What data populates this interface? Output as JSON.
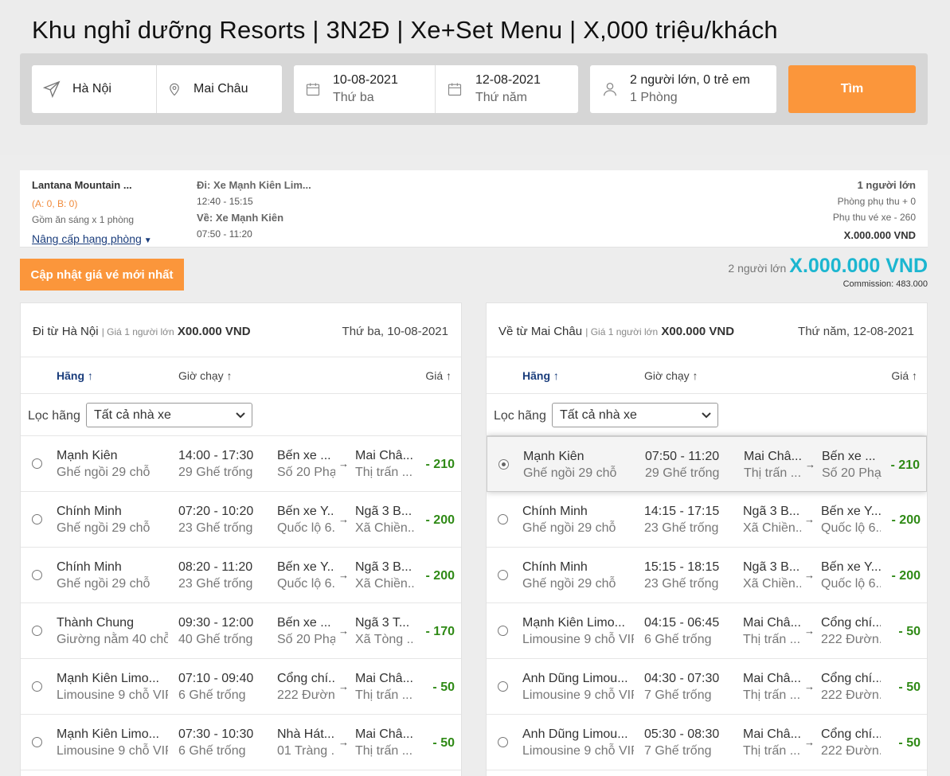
{
  "page": {
    "title": "Khu nghỉ dưỡng Resorts | 3N2Đ | Xe+Set Menu | X,000 triệu/khách"
  },
  "search": {
    "origin": "Hà Nội",
    "destination": "Mai Châu",
    "depart_date": "10-08-2021",
    "depart_day": "Thứ ba",
    "return_date": "12-08-2021",
    "return_day": "Thứ năm",
    "guests": "2 người lớn, 0 trẻ em",
    "rooms": "1 Phòng",
    "search_label": "Tìm"
  },
  "summary": {
    "hotel_name": "Lantana Mountain ...",
    "occupancy": "(A: 0, B: 0)",
    "meal": "Gồm ăn sáng x 1 phòng",
    "upgrade_label": "Nâng cấp hạng phòng",
    "outbound_label": "Đi: Xe Mạnh Kiên Lim...",
    "outbound_time": "12:40 - 15:15",
    "return_label": "Về: Xe Mạnh Kiên",
    "return_time": "07:50 - 11:20",
    "adults": "1 người lớn",
    "room_surcharge": "Phòng phụ thu + 0",
    "ticket_surcharge": "Phụ thu vé xe - 260",
    "total": "X.000.000 VND"
  },
  "actions": {
    "update_label": "Cập nhật giá vé mới nhất"
  },
  "price": {
    "pax": "2 người lớn",
    "total": "X.000.000 VND",
    "commission": "Commission: 483.000"
  },
  "outbound": {
    "from_label": "Đi từ Hà Nội",
    "price_note": "| Giá 1 người lớn",
    "price": "X00.000 VND",
    "date": "Thứ ba, 10-08-2021",
    "col_company": "Hãng ↑",
    "col_time": "Giờ chạy ↑",
    "col_price": "Giá ↑",
    "filter_label": "Lọc hãng",
    "filter_value": "Tất cả nhà xe",
    "rows": [
      {
        "name": "Mạnh Kiên",
        "type": "Ghế ngồi 29 chỗ",
        "time": "14:00 - 17:30",
        "seats": "29 Ghế trống",
        "from": "Bến xe ...",
        "from_addr": "Số 20 Phạ...",
        "to": "Mai Châ...",
        "to_addr": "Thị trấn ...",
        "price": "- 210",
        "selected": false
      },
      {
        "name": "Chính Minh",
        "type": "Ghế ngồi 29 chỗ",
        "time": "07:20 - 10:20",
        "seats": "23 Ghế trống",
        "from": "Bến xe Y...",
        "from_addr": "Quốc lộ 6...",
        "to": "Ngã 3 B...",
        "to_addr": "Xã Chiền...",
        "price": "- 200",
        "selected": false
      },
      {
        "name": "Chính Minh",
        "type": "Ghế ngồi 29 chỗ",
        "time": "08:20 - 11:20",
        "seats": "23 Ghế trống",
        "from": "Bến xe Y...",
        "from_addr": "Quốc lộ 6...",
        "to": "Ngã 3 B...",
        "to_addr": "Xã Chiền...",
        "price": "- 200",
        "selected": false
      },
      {
        "name": "Thành Chung",
        "type": "Giường nằm 40 chỗ",
        "time": "09:30 - 12:00",
        "seats": "40 Ghế trống",
        "from": "Bến xe ...",
        "from_addr": "Số 20 Phạ...",
        "to": "Ngã 3 T...",
        "to_addr": "Xã Tòng ...",
        "price": "- 170",
        "selected": false
      },
      {
        "name": "Mạnh Kiên Limo...",
        "type": "Limousine 9 chỗ VIP",
        "time": "07:10 - 09:40",
        "seats": "6 Ghế trống",
        "from": "Cổng chí...",
        "from_addr": "222 Đườn...",
        "to": "Mai Châ...",
        "to_addr": "Thị trấn ...",
        "price": "- 50",
        "selected": false
      },
      {
        "name": "Mạnh Kiên Limo...",
        "type": "Limousine 9 chỗ VIP",
        "time": "07:30 - 10:30",
        "seats": "6 Ghế trống",
        "from": "Nhà Hát...",
        "from_addr": "01 Tràng ...",
        "to": "Mai Châ...",
        "to_addr": "Thị trấn ...",
        "price": "- 50",
        "selected": false
      }
    ]
  },
  "return": {
    "from_label": "Về từ Mai Châu",
    "price_note": "| Giá 1 người lớn",
    "price": "X00.000 VND",
    "date": "Thứ năm, 12-08-2021",
    "col_company": "Hãng ↑",
    "col_time": "Giờ chạy ↑",
    "col_price": "Giá ↑",
    "filter_label": "Lọc hãng",
    "filter_value": "Tất cả nhà xe",
    "rows": [
      {
        "name": "Mạnh Kiên",
        "type": "Ghế ngồi 29 chỗ",
        "time": "07:50 - 11:20",
        "seats": "29 Ghế trống",
        "from": "Mai Châ...",
        "from_addr": "Thị trấn ...",
        "to": "Bến xe ...",
        "to_addr": "Số 20 Phạ...",
        "price": "- 210",
        "selected": true
      },
      {
        "name": "Chính Minh",
        "type": "Ghế ngồi 29 chỗ",
        "time": "14:15 - 17:15",
        "seats": "23 Ghế trống",
        "from": "Ngã 3 B...",
        "from_addr": "Xã Chiền...",
        "to": "Bến xe Y...",
        "to_addr": "Quốc lộ 6...",
        "price": "- 200",
        "selected": false
      },
      {
        "name": "Chính Minh",
        "type": "Ghế ngồi 29 chỗ",
        "time": "15:15 - 18:15",
        "seats": "23 Ghế trống",
        "from": "Ngã 3 B...",
        "from_addr": "Xã Chiền...",
        "to": "Bến xe Y...",
        "to_addr": "Quốc lộ 6...",
        "price": "- 200",
        "selected": false
      },
      {
        "name": "Mạnh Kiên Limo...",
        "type": "Limousine 9 chỗ VIP",
        "time": "04:15 - 06:45",
        "seats": "6 Ghế trống",
        "from": "Mai Châ...",
        "from_addr": "Thị trấn ...",
        "to": "Cổng chí...",
        "to_addr": "222 Đườn...",
        "price": "- 50",
        "selected": false
      },
      {
        "name": "Anh Dũng Limou...",
        "type": "Limousine 9 chỗ VIP",
        "time": "04:30 - 07:30",
        "seats": "7 Ghế trống",
        "from": "Mai Châ...",
        "from_addr": "Thị trấn ...",
        "to": "Cổng chí...",
        "to_addr": "222 Đườn...",
        "price": "- 50",
        "selected": false
      },
      {
        "name": "Anh Dũng Limou...",
        "type": "Limousine 9 chỗ VIP",
        "time": "05:30 - 08:30",
        "seats": "7 Ghế trống",
        "from": "Mai Châ...",
        "from_addr": "Thị trấn ...",
        "to": "Cổng chí...",
        "to_addr": "222 Đườn...",
        "price": "- 50",
        "selected": false
      }
    ]
  },
  "colors": {
    "accent": "#fb963b",
    "price_total": "#1cb6d0",
    "price_row": "#2f8a16",
    "link": "#1a3d7c"
  }
}
